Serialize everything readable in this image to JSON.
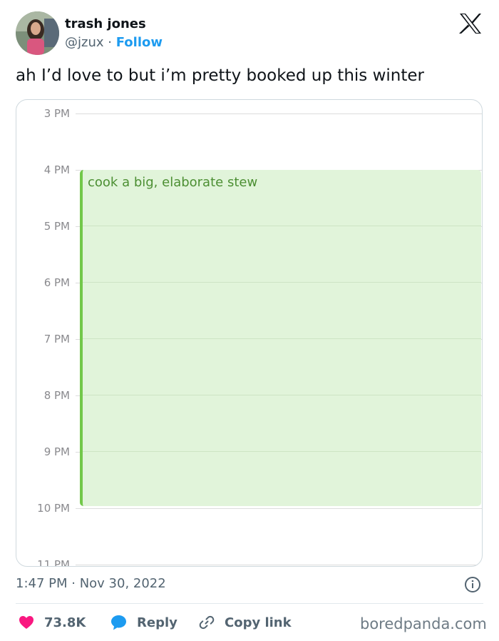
{
  "author": {
    "name": "trash jones",
    "handle": "@jzux",
    "separator": "·",
    "follow_label": "Follow"
  },
  "tweet": {
    "text": "ah I’d love to but i’m pretty booked up this winter",
    "timestamp": "1:47 PM · Nov 30, 2022"
  },
  "calendar": {
    "hours": [
      "3 PM",
      "4 PM",
      "5 PM",
      "6 PM",
      "7 PM",
      "8 PM",
      "9 PM",
      "10 PM",
      "11 PM"
    ],
    "event": {
      "title": "cook a big, elaborate stew",
      "color": "#72c84a",
      "background": "#e1f4da"
    }
  },
  "actions": {
    "likes": "73.8K",
    "reply_label": "Reply",
    "copy_label": "Copy link"
  },
  "watermark": "boredpanda.com",
  "icons": [
    "x-logo-icon",
    "info-icon",
    "heart-icon",
    "reply-bubble-icon",
    "link-icon"
  ]
}
